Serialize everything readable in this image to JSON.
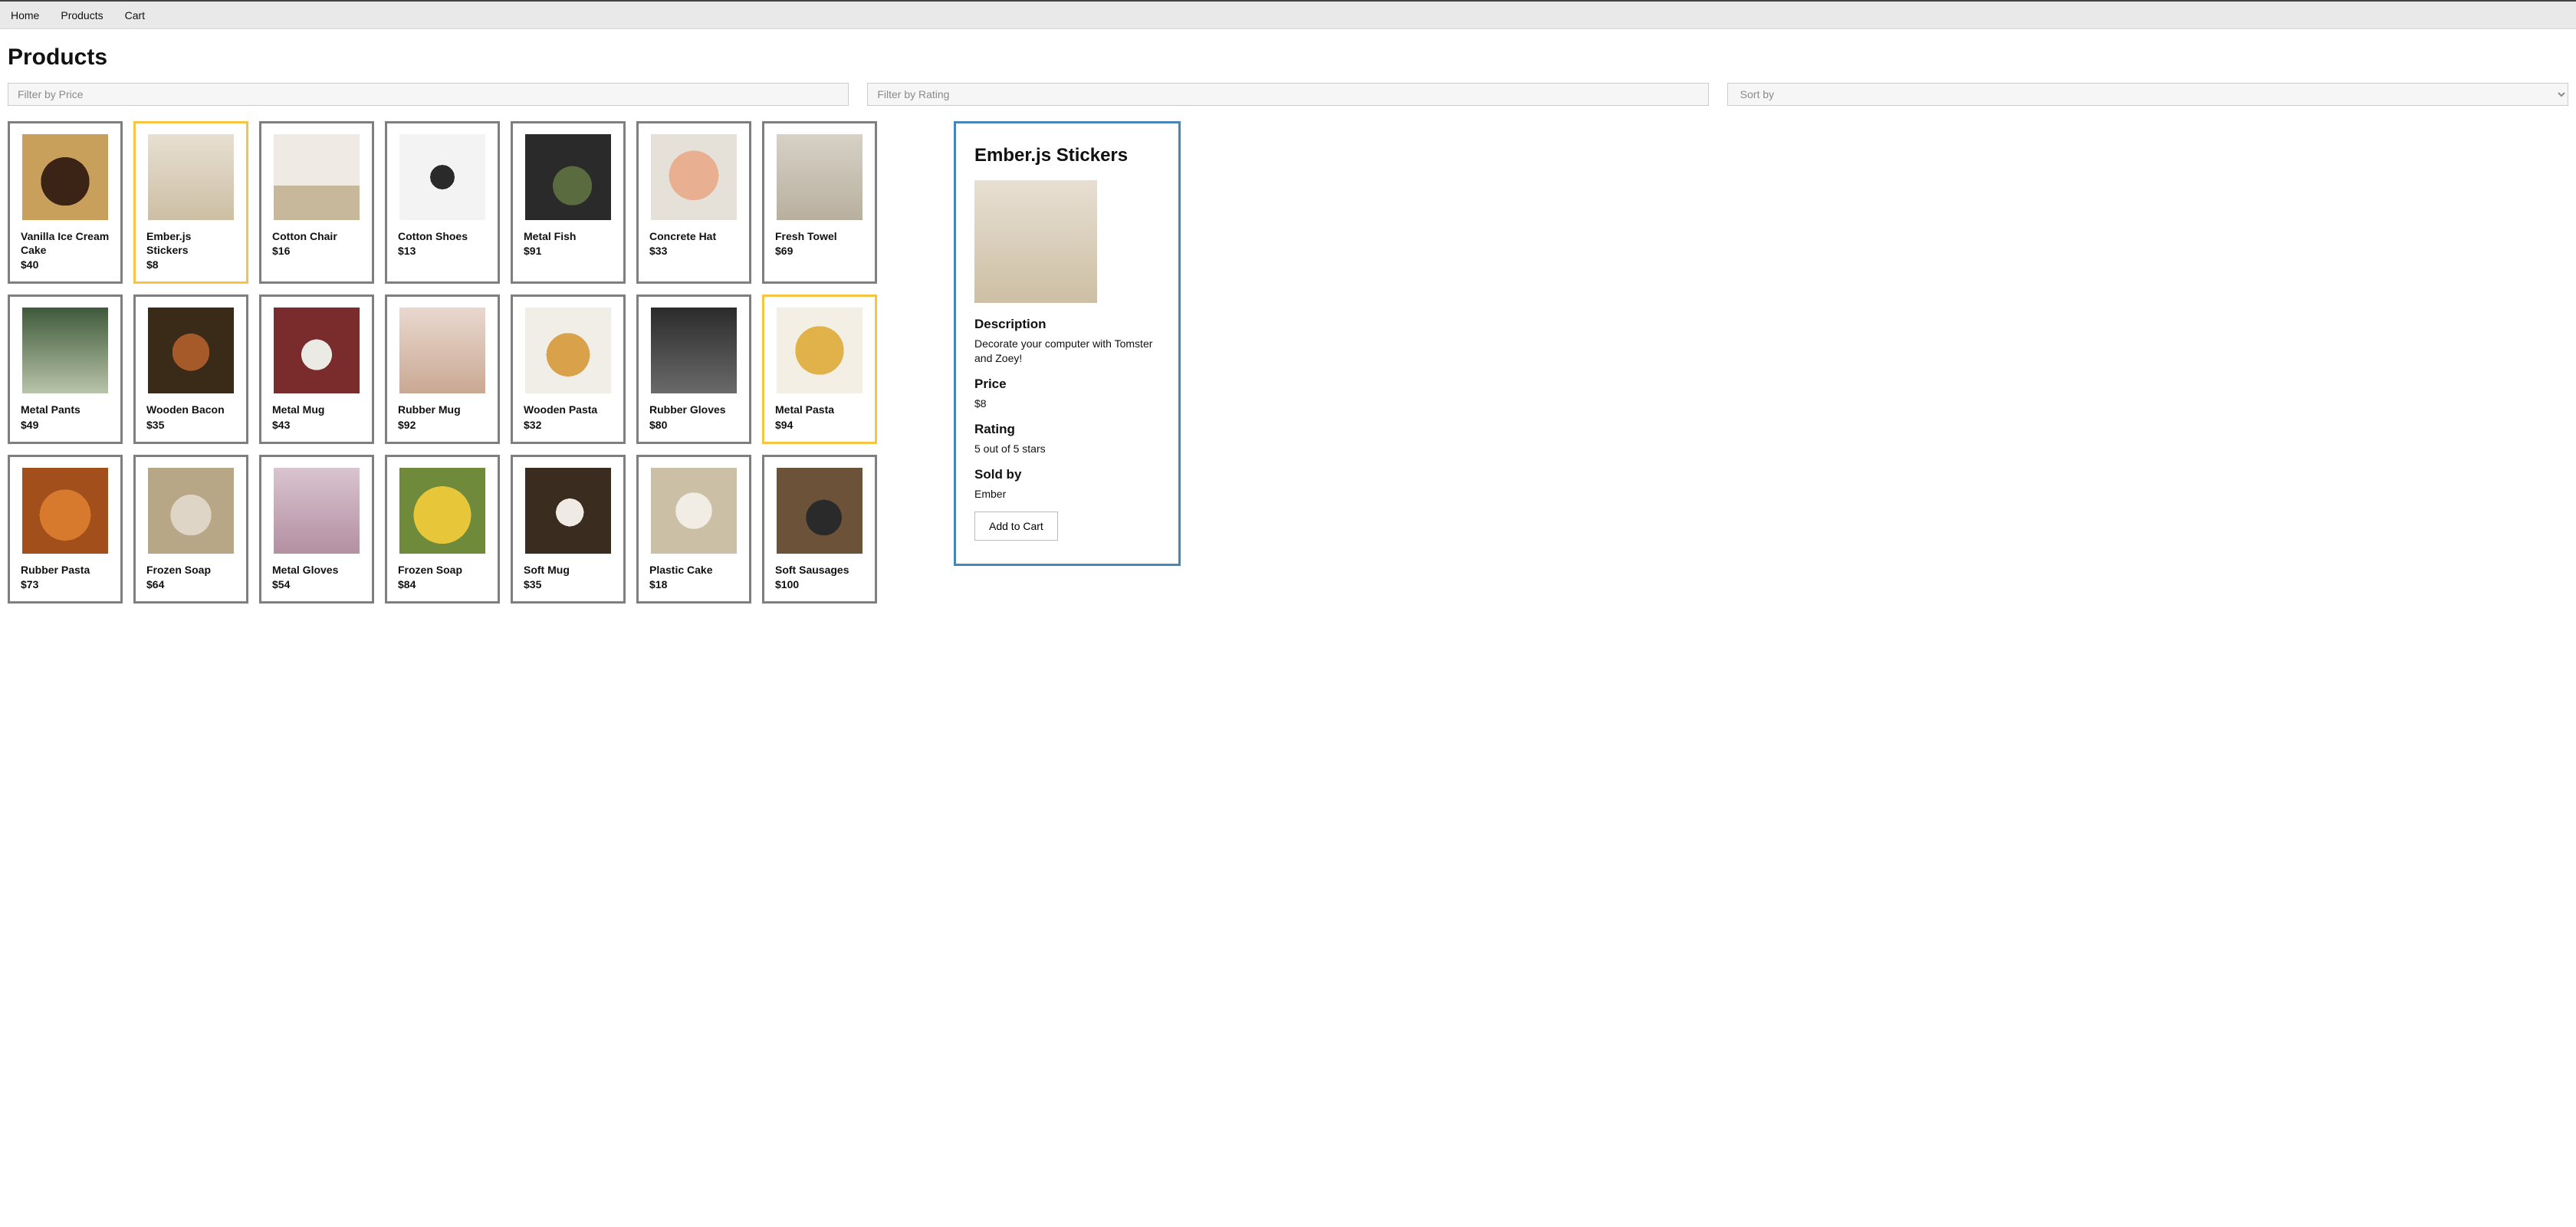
{
  "nav": {
    "home": "Home",
    "products": "Products",
    "cart": "Cart"
  },
  "page_title": "Products",
  "filters": {
    "price_placeholder": "Filter by Price",
    "rating_placeholder": "Filter by Rating",
    "sort_placeholder": "Sort by"
  },
  "products": [
    {
      "name": "Vanilla Ice Cream Cake",
      "price": "$40",
      "img": "img-cake",
      "selected": false
    },
    {
      "name": "Ember.js Stickers",
      "price": "$8",
      "img": "img-sticker",
      "selected": true
    },
    {
      "name": "Cotton Chair",
      "price": "$16",
      "img": "img-chair",
      "selected": false
    },
    {
      "name": "Cotton Shoes",
      "price": "$13",
      "img": "img-shoes",
      "selected": false
    },
    {
      "name": "Metal Fish",
      "price": "$91",
      "img": "img-fish",
      "selected": false
    },
    {
      "name": "Concrete Hat",
      "price": "$33",
      "img": "img-hat",
      "selected": false
    },
    {
      "name": "Fresh Towel",
      "price": "$69",
      "img": "img-towel",
      "selected": false
    },
    {
      "name": "Metal Pants",
      "price": "$49",
      "img": "img-pants",
      "selected": false
    },
    {
      "name": "Wooden Bacon",
      "price": "$35",
      "img": "img-bacon",
      "selected": false
    },
    {
      "name": "Metal Mug",
      "price": "$43",
      "img": "img-mug",
      "selected": false
    },
    {
      "name": "Rubber Mug",
      "price": "$92",
      "img": "img-rmug",
      "selected": false
    },
    {
      "name": "Wooden Pasta",
      "price": "$32",
      "img": "img-wpasta",
      "selected": false
    },
    {
      "name": "Rubber Gloves",
      "price": "$80",
      "img": "img-gloves",
      "selected": false
    },
    {
      "name": "Metal Pasta",
      "price": "$94",
      "img": "img-mpasta",
      "selected": true
    },
    {
      "name": "Rubber Pasta",
      "price": "$73",
      "img": "img-rpasta",
      "selected": false
    },
    {
      "name": "Frozen Soap",
      "price": "$64",
      "img": "img-fsoap",
      "selected": false
    },
    {
      "name": "Metal Gloves",
      "price": "$54",
      "img": "img-mgloves",
      "selected": false
    },
    {
      "name": "Frozen Soap",
      "price": "$84",
      "img": "img-fsoap2",
      "selected": false
    },
    {
      "name": "Soft Mug",
      "price": "$35",
      "img": "img-smug",
      "selected": false
    },
    {
      "name": "Plastic Cake",
      "price": "$18",
      "img": "img-pcake",
      "selected": false
    },
    {
      "name": "Soft Sausages",
      "price": "$100",
      "img": "img-sausage",
      "selected": false
    }
  ],
  "detail": {
    "title": "Ember.js Stickers",
    "img": "img-sticker",
    "labels": {
      "description": "Description",
      "price": "Price",
      "rating": "Rating",
      "sold_by": "Sold by",
      "add_to_cart": "Add to Cart"
    },
    "description_text": "Decorate your computer with Tomster and Zoey!",
    "price_text": "$8",
    "rating_text": "5 out of 5 stars",
    "seller_text": "Ember"
  }
}
